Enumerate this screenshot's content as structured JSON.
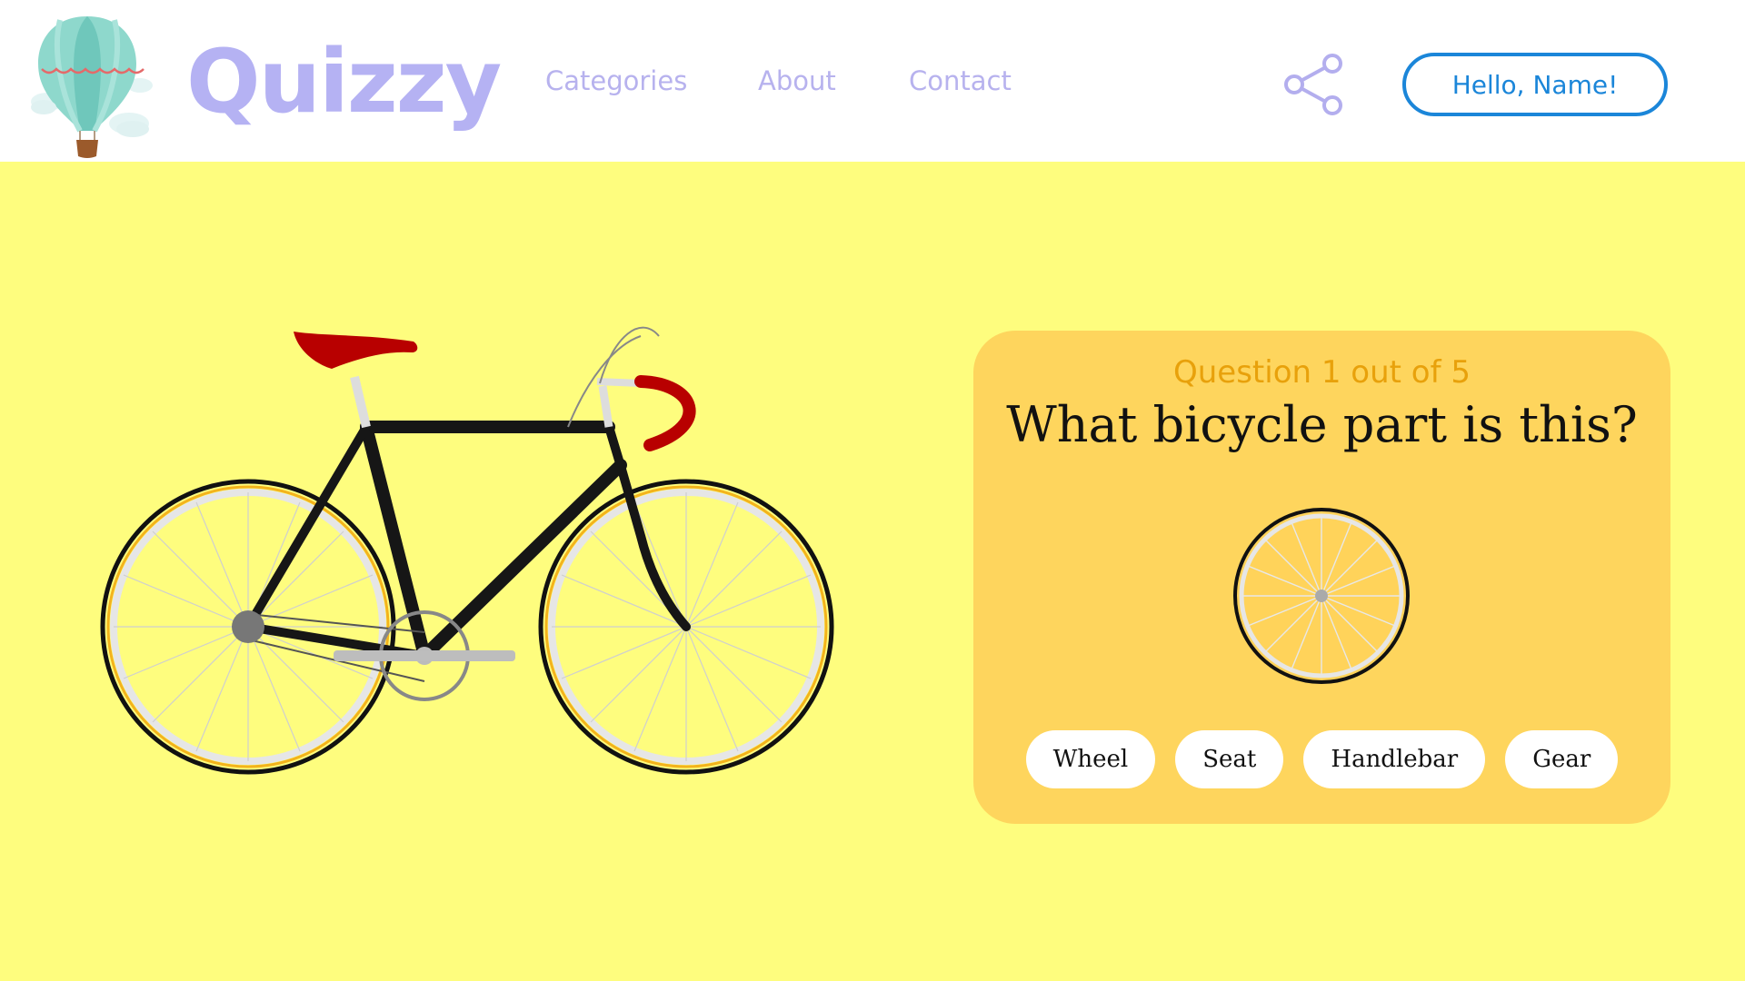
{
  "header": {
    "brand": "Quizzy",
    "nav": [
      "Categories",
      "About",
      "Contact"
    ],
    "share_icon": "share-icon",
    "greeting_button": "Hello, Name!"
  },
  "quiz": {
    "counter": "Question 1 out of 5",
    "question": "What bicycle part is this?",
    "answers": [
      "Wheel",
      "Seat",
      "Handlebar",
      "Gear"
    ]
  },
  "colors": {
    "page_background": "#fefd7e",
    "card_background": "#fed55d",
    "brand": "#b5b2f3",
    "accent_blue": "#1b86d9",
    "counter_text": "#e8a10b"
  }
}
